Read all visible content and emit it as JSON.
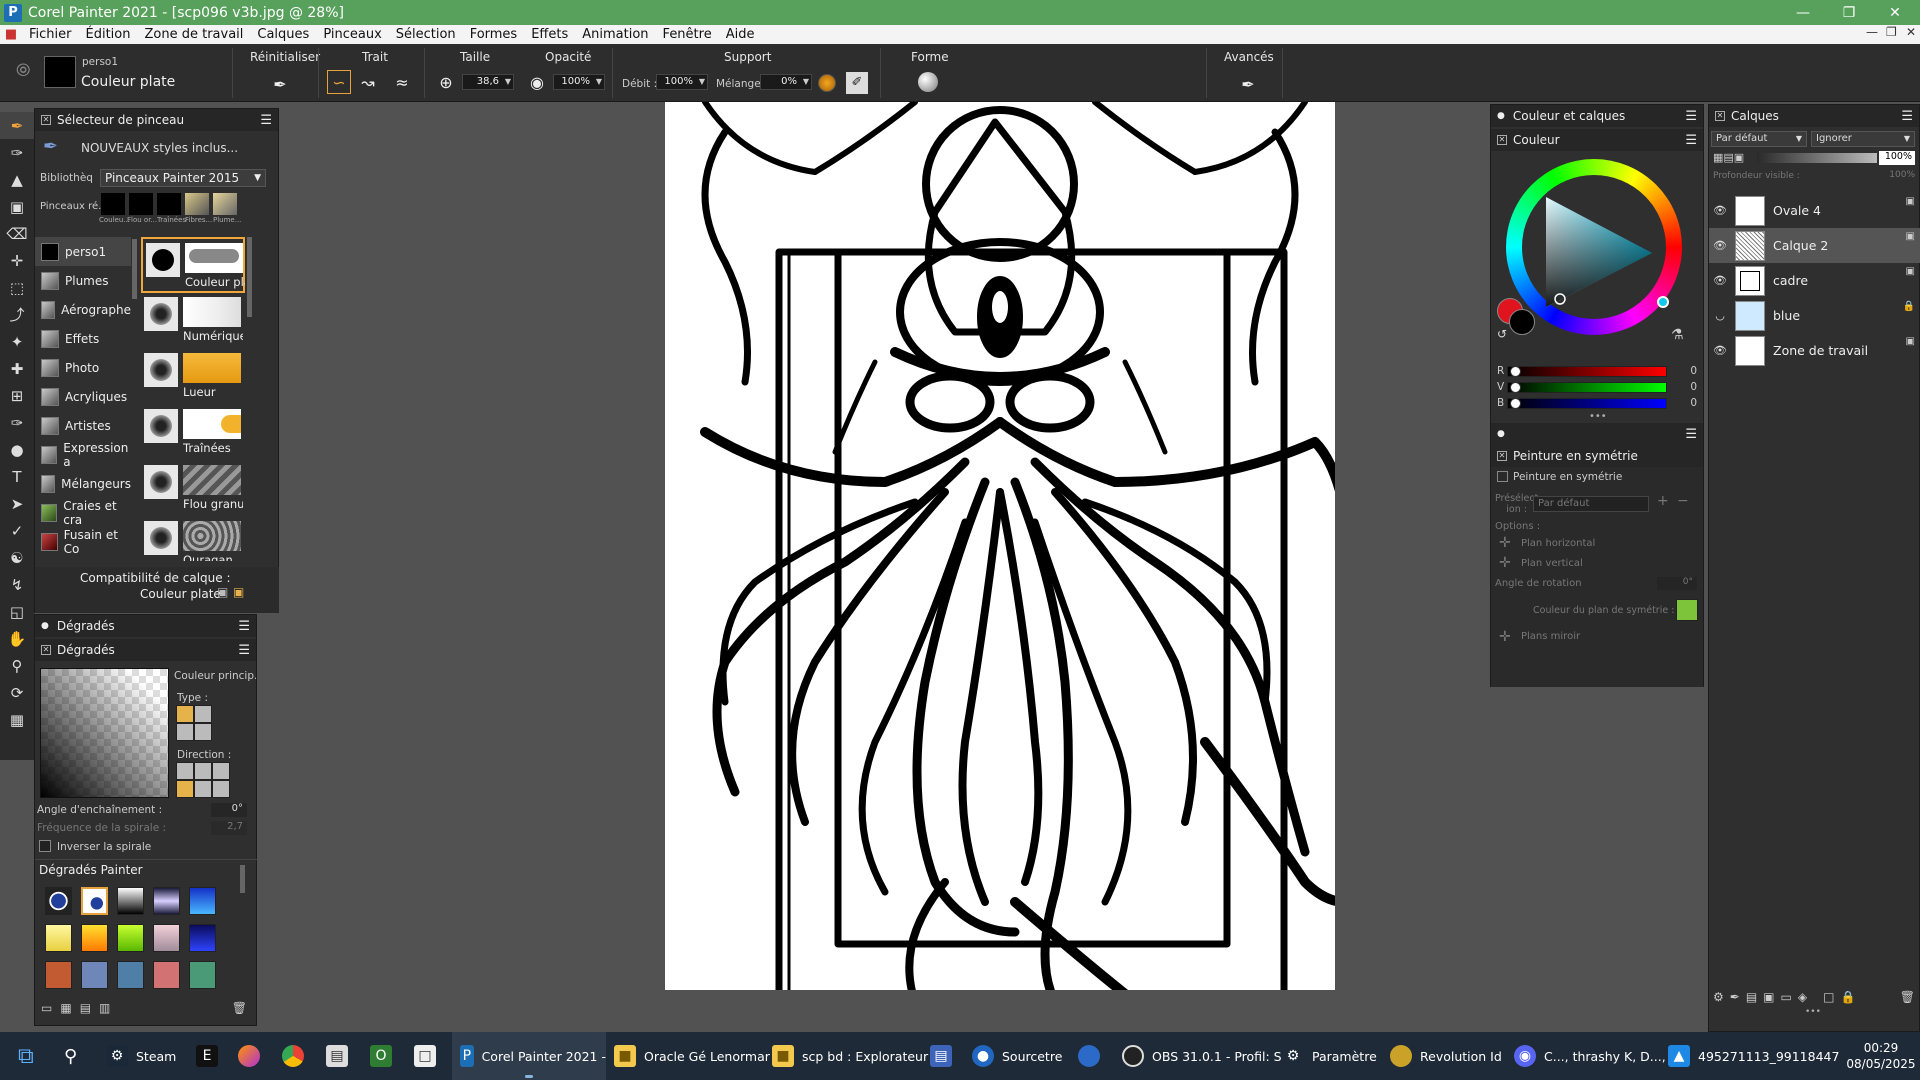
{
  "window": {
    "title": "Corel Painter 2021 - [scp096 v3b.jpg @ 28%]",
    "app_icon_letter": "P"
  },
  "menu": [
    "Fichier",
    "Édition",
    "Zone de travail",
    "Calques",
    "Pinceaux",
    "Sélection",
    "Formes",
    "Effets",
    "Animation",
    "Fenêtre",
    "Aide"
  ],
  "propbar": {
    "brush_name_top": "perso1",
    "brush_name": "Couleur plate",
    "reset_label": "Réinitialiser",
    "stroke_label": "Trait",
    "size_label": "Taille",
    "size_value": "38,6",
    "opacity_label": "Opacité",
    "opacity_value": "100%",
    "support_label": "Support",
    "flow_label": "Débit :",
    "flow_value": "100%",
    "mix_label": "Mélange :",
    "mix_value": "0%",
    "form_label": "Forme",
    "advanced_label": "Avancés"
  },
  "brush_selector": {
    "title": "Sélecteur de pinceau",
    "promo": "NOUVEAUX styles inclus...",
    "library_label": "Bibliothèq...",
    "library_value": "Pinceaux Painter 2015",
    "recent_label": "Pinceaux ré...",
    "recent": [
      "Couleu...",
      "Flou or...",
      "Traînées",
      "Fibres...",
      "Plume..."
    ],
    "categories": [
      "perso1",
      "Plumes",
      "Aérographe",
      "Effets",
      "Photo",
      "Acryliques",
      "Artistes",
      "Expression a",
      "Mélangeurs",
      "Craies et cra",
      "Fusain et Co"
    ],
    "variants": [
      "Couleur plate",
      "Numérique lis",
      "Lueur",
      "Traînées",
      "Flou granuleu",
      "Ouragan"
    ],
    "compat_label": "Compatibilité de calque :",
    "compat_value": "Couleur plate"
  },
  "gradients": {
    "outer_title": "Dégradés",
    "inner_title": "Dégradés",
    "main_color_label": "Couleur princip...",
    "type_label": "Type :",
    "direction_label": "Direction :",
    "angle_label": "Angle d'enchaînement :",
    "angle_value": "0°",
    "spiral_freq_label": "Fréquence de la spirale :",
    "spiral_freq_value": "2,7",
    "invert_label": "Inverser la spirale",
    "library_title": "Dégradés Painter"
  },
  "color_layers": {
    "title": "Couleur et calques",
    "color_tab": "Couleur",
    "r_label": "R",
    "v_label": "V",
    "b_label": "B",
    "r_value": "0",
    "v_value": "0",
    "b_value": "0",
    "main_color": "#e0141e",
    "secondary_color": "#000000"
  },
  "symmetry": {
    "title": "Peinture en symétrie",
    "checkbox_label": "Peinture en symétrie",
    "preset_label": "Présélect ion :",
    "preset_value": "Par défaut",
    "options_label": "Options :",
    "plane_h": "Plan horizontal",
    "plane_v": "Plan vertical",
    "rotation_label": "Angle de rotation",
    "rotation_value": "0°",
    "plane_color_label": "Couleur du plan de symétrie :",
    "plane_color": "#7dc43a",
    "mirror_label": "Plans miroir"
  },
  "layers": {
    "title": "Calques",
    "blend_mode": "Par défaut",
    "composite": "Ignorer",
    "opacity": "100%",
    "depth_label": "Profondeur visible :",
    "depth_value": "100%",
    "items": [
      {
        "name": "Ovale 4",
        "selected": false
      },
      {
        "name": "Calque 2",
        "selected": true
      },
      {
        "name": "cadre",
        "selected": false
      },
      {
        "name": "blue",
        "selected": false
      },
      {
        "name": "Zone de travail",
        "selected": false
      }
    ]
  },
  "taskbar": {
    "items": [
      "Steam",
      "Corel Painter 2021 -",
      "Oracle Gé Lenormar",
      "scp bd : Explorateur",
      "Sourcetre",
      "OBS 31.0.1 - Profil: S",
      "Paramètre",
      "Revolution Id",
      "C..., thrashy K, D..., !",
      "495271113_99118447"
    ],
    "time": "00:29",
    "date": "08/05/2025"
  }
}
